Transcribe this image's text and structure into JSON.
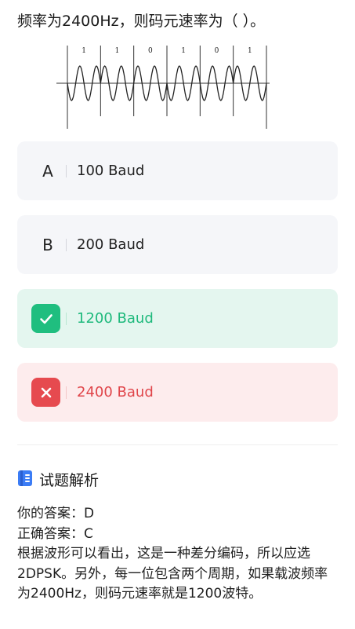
{
  "question": {
    "text": "频率为2400Hz，则码元速率为（ ）。",
    "bits": [
      "1",
      "1",
      "0",
      "1",
      "0",
      "1"
    ]
  },
  "options": [
    {
      "letter": "A",
      "text": "100 Baud",
      "state": "normal"
    },
    {
      "letter": "B",
      "text": "200 Baud",
      "state": "normal"
    },
    {
      "letter": "C",
      "text": "1200 Baud",
      "state": "correct"
    },
    {
      "letter": "D",
      "text": "2400 Baud",
      "state": "wrong"
    }
  ],
  "analysis": {
    "title": "试题解析",
    "your_answer": "你的答案：D",
    "correct_answer": "正确答案：C",
    "explanation": "根据波形可以看出，这是一种差分编码，所以应选2DPSK。另外，每一位包含两个周期，如果载波频率为2400Hz，则码元速率就是1200波特。"
  },
  "colors": {
    "correct": "#1fbe7f",
    "wrong": "#e64a4f",
    "icon_blue": "#3b7cf5"
  },
  "icons": {
    "correct": "check-icon",
    "wrong": "cross-icon",
    "analysis": "document-icon"
  }
}
